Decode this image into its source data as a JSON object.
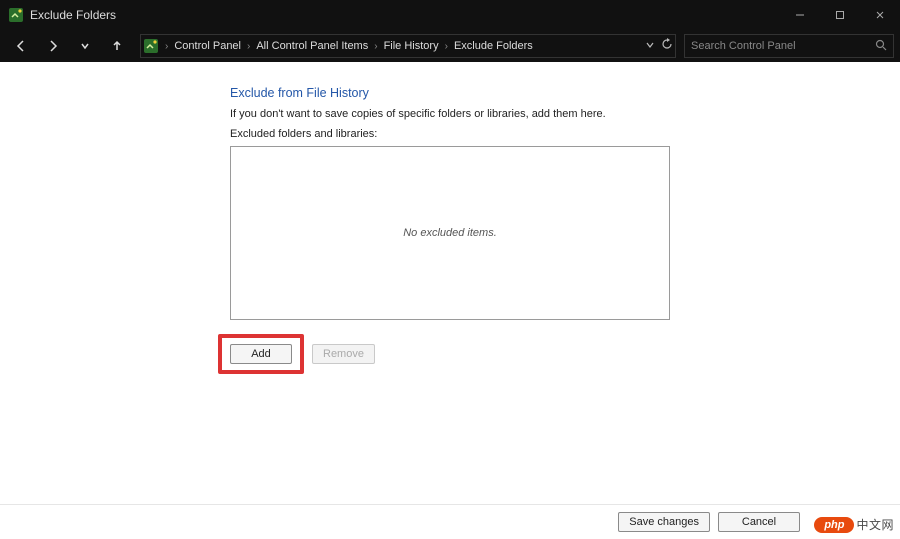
{
  "window": {
    "title": "Exclude Folders"
  },
  "breadcrumbs": {
    "items": [
      "Control Panel",
      "All Control Panel Items",
      "File History",
      "Exclude Folders"
    ]
  },
  "search": {
    "placeholder": "Search Control Panel"
  },
  "page": {
    "heading": "Exclude from File History",
    "description": "If you don't want to save copies of specific folders or libraries, add them here.",
    "list_label": "Excluded folders and libraries:",
    "empty_message": "No excluded items.",
    "add_label": "Add",
    "remove_label": "Remove"
  },
  "footer": {
    "save_label": "Save changes",
    "cancel_label": "Cancel"
  },
  "watermark": {
    "badge": "php",
    "text": "中文网"
  }
}
